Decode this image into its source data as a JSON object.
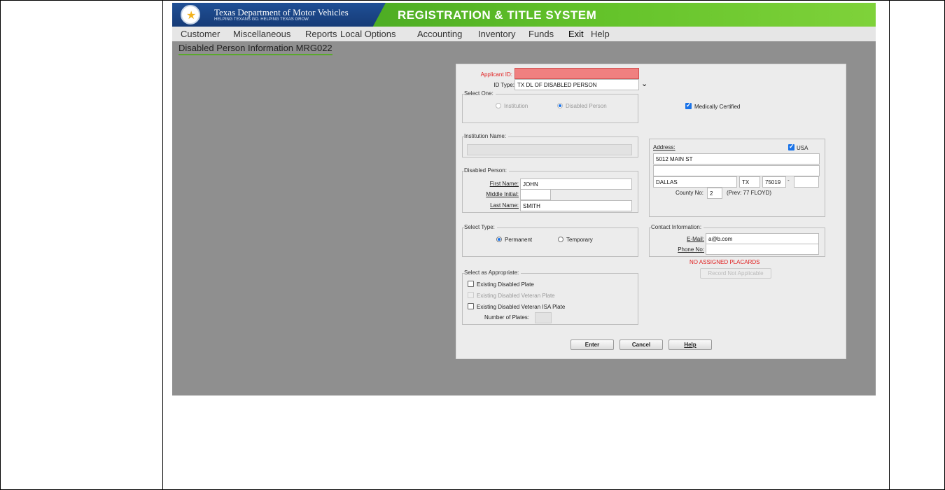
{
  "banner": {
    "dept": "Texas Department of Motor Vehicles",
    "tagline": "HELPING TEXANS GO. HELPING TEXAS GROW.",
    "system_title": "REGISTRATION & TITLE SYSTEM"
  },
  "menu": [
    "Customer",
    "Miscellaneous",
    "Reports",
    "Local Options",
    "Accounting",
    "Inventory",
    "Funds",
    "Exit",
    "Help"
  ],
  "screen_title": "Disabled Person Information MRG022",
  "form": {
    "applicant_id_label": "Applicant ID:",
    "applicant_id_value": "",
    "id_type_label": "ID Type:",
    "id_type_value": "TX DL OF DISABLED PERSON",
    "select_one_title": "Select One:",
    "institution_radio": "Institution",
    "disabled_person_radio": "Disabled Person",
    "medically_certified": "Medically Certified",
    "institution_name_title": "Institution Name:",
    "institution_name_value": "",
    "address_title": "Address:",
    "usa_label": "USA",
    "address_line1": "5012 MAIN ST",
    "address_line2": "",
    "city": "DALLAS",
    "state": "TX",
    "zip": "75019",
    "zip_ext": "",
    "zip_dash": "-",
    "county_label": "County No:",
    "county_value": "2",
    "prev_county": "(Prev: 77 FLOYD)",
    "disabled_person_title": "Disabled Person:",
    "first_name_label": "First Name:",
    "first_name_value": "JOHN",
    "middle_initial_label": "Middle Initial:",
    "middle_initial_value": "",
    "last_name_label": "Last Name:",
    "last_name_value": "SMITH",
    "select_type_title": "Select Type:",
    "permanent_label": "Permanent",
    "temporary_label": "Temporary",
    "contact_title": "Contact Information:",
    "email_label": "E-Mail:",
    "email_value": "a@b.com",
    "phone_label": "Phone No:",
    "phone_value": "",
    "no_placards": "NO ASSIGNED PLACARDS",
    "record_not_applicable": "Record Not Applicable",
    "select_appropriate_title": "Select as Appropriate:",
    "existing_disabled_plate": "Existing Disabled Plate",
    "existing_disabled_veteran_plate": "Existing Disabled Veteran Plate",
    "existing_disabled_veteran_isa_plate": "Existing Disabled Veteran ISA Plate",
    "number_of_plates_label": "Number of Plates:",
    "number_of_plates_value": ""
  },
  "buttons": {
    "enter": "Enter",
    "cancel": "Cancel",
    "help": "Help"
  },
  "colors": {
    "accent_green": "#5aa82b",
    "error_red": "#e02020",
    "error_field": "#f08080",
    "check_blue": "#1a73e8"
  }
}
